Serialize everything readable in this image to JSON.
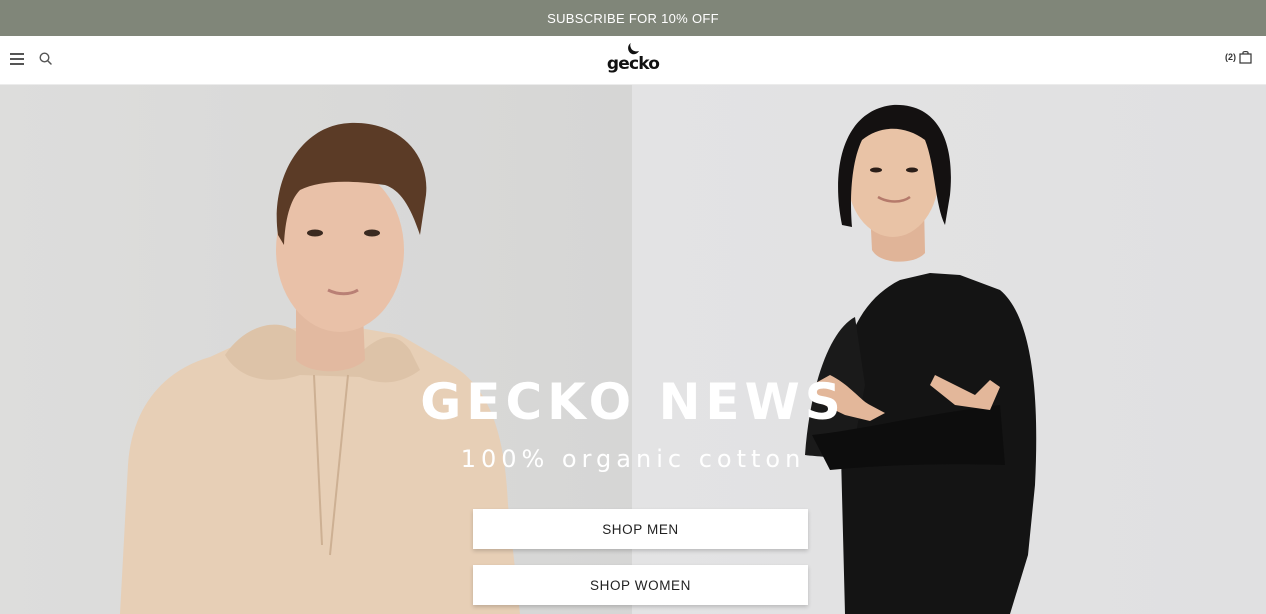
{
  "promo": {
    "text": "SUBSCRIBE FOR 10% OFF"
  },
  "header": {
    "logo_text": "gecko",
    "cart_count": "(2)",
    "icons": {
      "menu": "menu-icon",
      "search": "search-icon",
      "cart": "shopping-bag-icon",
      "logo": "moon-icon"
    }
  },
  "hero": {
    "title": "GECKO NEWS",
    "subtitle": "100% organic cotton",
    "buttons": {
      "men": "SHOP MEN",
      "women": "SHOP WOMEN"
    }
  },
  "colors": {
    "promo_bg": "#808679",
    "promo_text": "#ffffff",
    "button_bg": "#ffffff",
    "hoodie": "#e7cfb6",
    "sweatshirt": "#141414"
  }
}
